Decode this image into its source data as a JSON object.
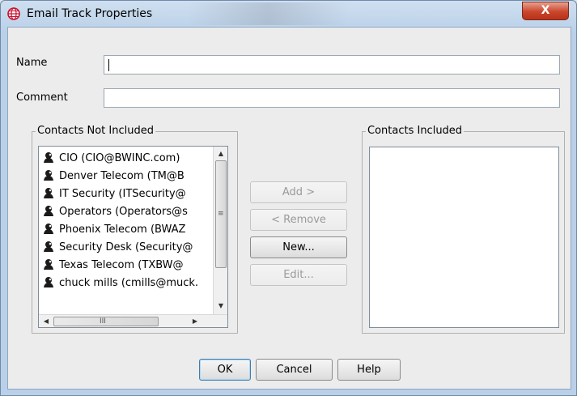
{
  "window": {
    "title": "Email Track Properties",
    "close_label": "X"
  },
  "form": {
    "name_label": "Name",
    "name_value": "",
    "comment_label": "Comment",
    "comment_value": ""
  },
  "not_included": {
    "title": "Contacts Not Included",
    "items": [
      {
        "label": "CIO (CIO@BWINC.com)"
      },
      {
        "label": "Denver Telecom  (TM@B"
      },
      {
        "label": "IT Security (ITSecurity@"
      },
      {
        "label": "Operators (Operators@s"
      },
      {
        "label": "Phoenix Telecom (BWAZ"
      },
      {
        "label": "Security Desk (Security@"
      },
      {
        "label": "Texas Telecom (TXBW@"
      },
      {
        "label": "chuck mills (cmills@muck."
      }
    ],
    "scroll_grip": "III"
  },
  "included": {
    "title": "Contacts Included",
    "items": []
  },
  "actions": {
    "add": "Add >",
    "remove": "< Remove",
    "new": "New...",
    "edit": "Edit..."
  },
  "footer": {
    "ok": "OK",
    "cancel": "Cancel",
    "help": "Help"
  },
  "colors": {
    "close_button": "#c9452b",
    "window_frame": "#b9d0e8",
    "app_icon": "#c8102e"
  }
}
